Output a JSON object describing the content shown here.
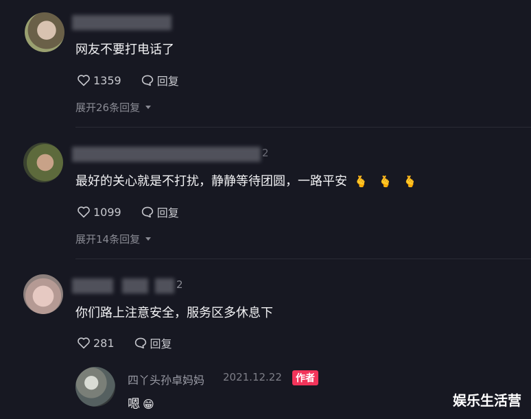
{
  "comments": [
    {
      "text": "网友不要打电话了",
      "likes": "1359",
      "reply_label": "回复",
      "expand_label": "展开26条回复"
    },
    {
      "name_suffix": "2",
      "text": "最好的关心就是不打扰，静静等待团圆，一路平安",
      "emojis": [
        "🫰",
        "🫰",
        "🫰"
      ],
      "likes": "1099",
      "reply_label": "回复",
      "expand_label": "展开14条回复"
    },
    {
      "name_suffix": "2",
      "text": "你们路上注意安全，服务区多休息下",
      "likes": "281",
      "reply_label": "回复",
      "reply": {
        "author": "四丫头孙卓妈妈",
        "date": "2021.12.22",
        "badge": "作者",
        "text": "嗯",
        "emoji": "😁"
      }
    }
  ],
  "watermark": "娱乐生活营",
  "colors": {
    "background": "#171822",
    "author_badge": "#f2345a",
    "muted_text": "#8a8b94"
  }
}
